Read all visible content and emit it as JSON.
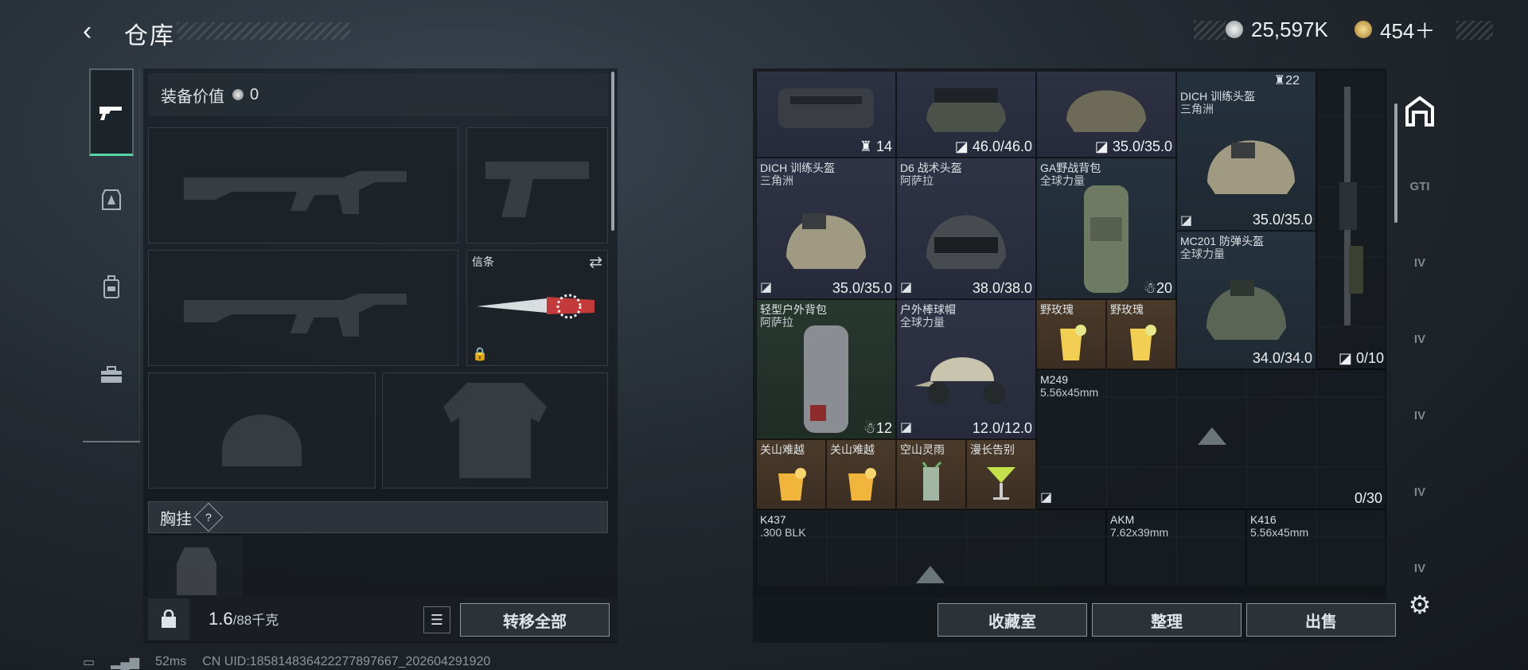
{
  "header": {
    "back_icon": "‹",
    "title": "仓库"
  },
  "currency": {
    "primary": "25,597K",
    "secondary": "454＋",
    "primary_color": "#d0d4d8",
    "secondary_color": "#d8b867"
  },
  "left_tabs": [
    "weapon-icon",
    "armor-icon",
    "backpack-icon",
    "toolbox-icon"
  ],
  "equipment": {
    "value_label": "装备价值",
    "value": "0",
    "melee_label": "信条",
    "chest_label": "胸挂",
    "chest_help": "?"
  },
  "footer_left": {
    "weight": "1.6",
    "weight_max": "/88千克",
    "transfer_all": "转移全部"
  },
  "stash_items": [
    {
      "id": "bag-top",
      "armor": "14"
    },
    {
      "id": "helmet-top-1",
      "durability": "46.0/46.0"
    },
    {
      "id": "helmet-top-2",
      "durability": "35.0/35.0"
    },
    {
      "id": "counter-top",
      "count": "22"
    },
    {
      "id": "dich-top",
      "name": "DICH 训练头盔",
      "sub": "三角洲",
      "durability": "35.0/35.0"
    },
    {
      "id": "dich-1",
      "name": "DICH 训练头盔",
      "sub": "三角洲",
      "durability": "35.0/35.0"
    },
    {
      "id": "d6",
      "name": "D6 战术头盔",
      "sub": "阿萨拉",
      "durability": "38.0/38.0"
    },
    {
      "id": "ga-pack",
      "name": "GA野战背包",
      "sub": "全球力量",
      "armor": "20"
    },
    {
      "id": "mc201",
      "name": "MC201 防弹头盔",
      "sub": "全球力量",
      "durability": "34.0/34.0"
    },
    {
      "id": "light-pack",
      "name": "轻型户外背包",
      "sub": "阿萨拉",
      "armor": "12"
    },
    {
      "id": "baseball-cap",
      "name": "户外棒球帽",
      "sub": "全球力量",
      "durability": "12.0/12.0"
    },
    {
      "id": "drink-1",
      "name": "野玫瑰"
    },
    {
      "id": "drink-2",
      "name": "野玫瑰"
    },
    {
      "id": "drink-3",
      "name": "关山难越"
    },
    {
      "id": "drink-4",
      "name": "关山难越"
    },
    {
      "id": "drink-5",
      "name": "空山灵雨"
    },
    {
      "id": "drink-6",
      "name": "漫长告别"
    },
    {
      "id": "rifle-right",
      "durability": "0/10"
    },
    {
      "id": "m249",
      "name": "M249",
      "sub": "5.56x45mm",
      "durability": "0/30"
    },
    {
      "id": "k437",
      "name": "K437",
      "sub": ".300 BLK"
    },
    {
      "id": "akm",
      "name": "AKM",
      "sub": "7.62x39mm"
    },
    {
      "id": "k416",
      "name": "K416",
      "sub": "5.56x45mm"
    }
  ],
  "stash_footer": {
    "collection": "收藏室",
    "organize": "整理",
    "sell": "出售"
  },
  "right_tabs": [
    "stash-icon",
    "GTI",
    "IV",
    "IV",
    "IV",
    "IV",
    "IV"
  ],
  "status_bar": {
    "ping": "52ms",
    "uid": "CN UID:1858148364222778976­67_202604291920"
  }
}
